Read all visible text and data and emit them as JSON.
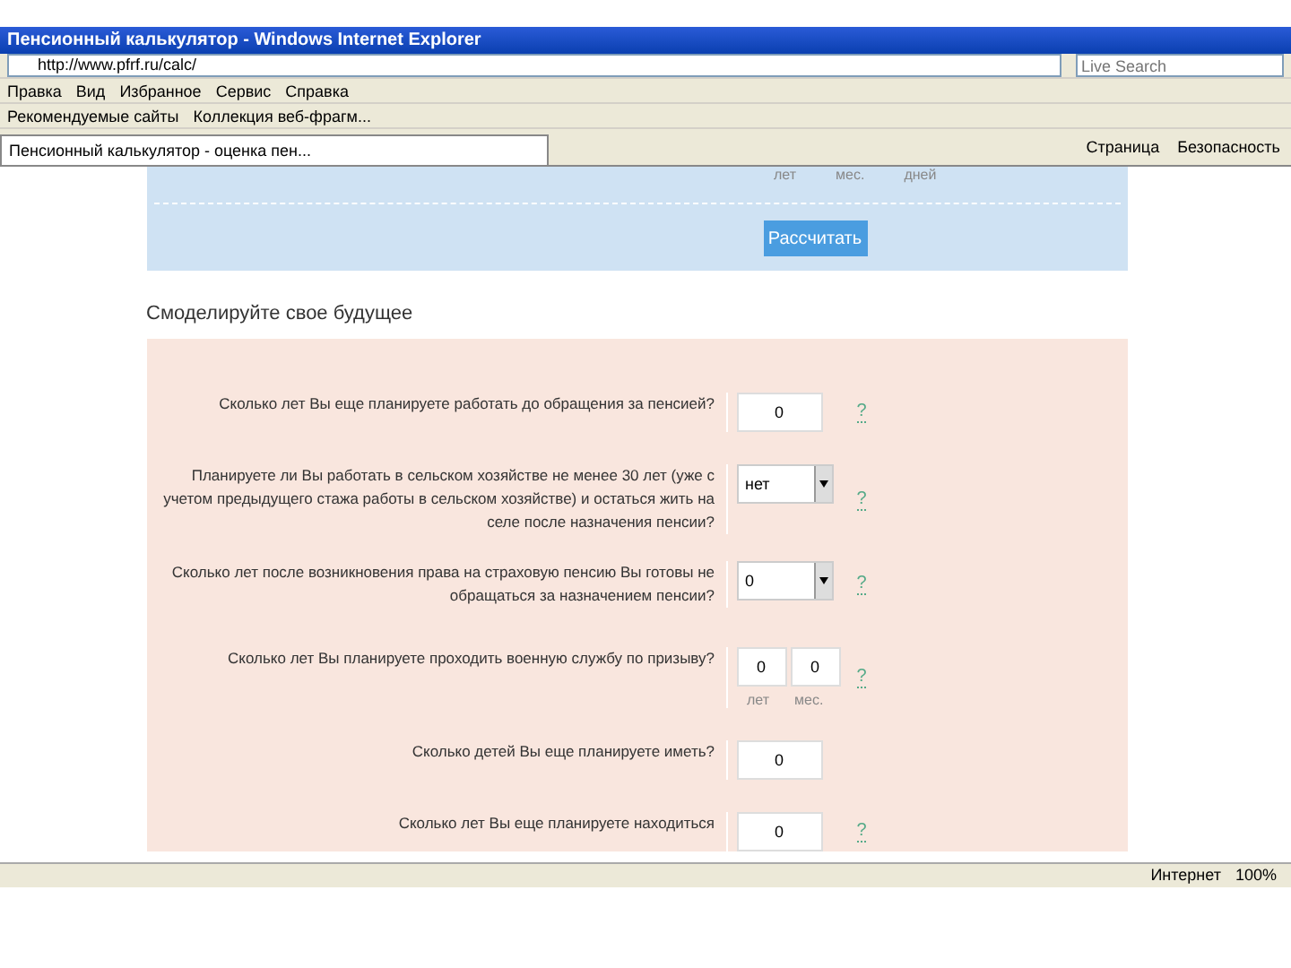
{
  "window": {
    "title": "Пенсионный калькулятор - Windows Internet Explorer"
  },
  "address_bar": {
    "url": "http://www.pfrf.ru/calc/",
    "search_placeholder": "Live Search"
  },
  "menu": [
    "Правка",
    "Вид",
    "Избранное",
    "Сервис",
    "Справка"
  ],
  "favorites": [
    "Рекомендуемые сайты",
    "Коллекция веб-фрагм..."
  ],
  "tab": {
    "label": "Пенсионный калькулятор - оценка пен..."
  },
  "command_bar": [
    "Страница",
    "Безопасность"
  ],
  "calc_panel": {
    "units": [
      "лет",
      "мес.",
      "дней"
    ],
    "button": "Рассчитать"
  },
  "heading": "Смоделируйте свое будущее",
  "questions": [
    {
      "kind": "input",
      "label": "Сколько лет Вы еще планируете работать до обращения за пенсией?",
      "value": "0",
      "help": "?"
    },
    {
      "kind": "select",
      "label": "Планируете ли Вы работать в сельском хозяйстве не менее 30 лет (уже с учетом предыдущего стажа работы в сельском хозяйстве) и остаться жить на селе после назначения пенсии?",
      "value": "нет",
      "help": "?"
    },
    {
      "kind": "select",
      "label": "Сколько лет после возникновения права на страховую пенсию Вы готовы не обращаться за назначением пенсии?",
      "value": "0",
      "help": "?"
    },
    {
      "kind": "pair",
      "label": "Сколько лет Вы планируете проходить военную службу по призыву?",
      "values": [
        "0",
        "0"
      ],
      "units": [
        "лет",
        "мес."
      ],
      "help": "?"
    },
    {
      "kind": "input",
      "label": "Сколько детей Вы еще планируете иметь?",
      "value": "0"
    },
    {
      "kind": "input",
      "label": "Сколько лет Вы еще планируете находиться",
      "value": "0",
      "help": "?"
    }
  ],
  "status_bar": {
    "zone": "Интернет",
    "zoom": "100%"
  }
}
